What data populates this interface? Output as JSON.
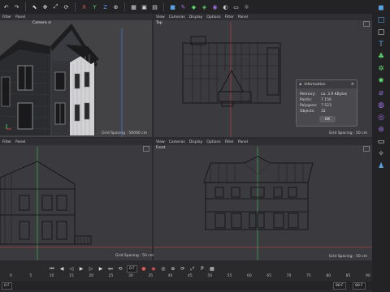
{
  "toolbar": {
    "icons": [
      "undo-icon",
      "redo-icon",
      "select-icon",
      "move-icon",
      "scale-icon",
      "rotate-icon",
      "x-axis-icon",
      "y-axis-icon",
      "z-axis-icon",
      "coordinate-icon",
      "render-view-icon",
      "render-icon",
      "render-settings-icon",
      "cube-icon",
      "pen-icon",
      "subdivision-icon",
      "cloner-icon",
      "deformer-icon",
      "scene-icon",
      "camera-icon",
      "light-icon"
    ],
    "x_label": "X",
    "y_label": "Y",
    "z_label": "Z"
  },
  "viewports": {
    "perspective": {
      "menu": [
        "Filter",
        "Panel"
      ],
      "label": "Camera",
      "camera_icon": "⊙",
      "grid_spacing": "Grid Spacing : 50000 cm"
    },
    "top": {
      "menu": [
        "View",
        "Cameras",
        "Display",
        "Options",
        "Filter",
        "Panel"
      ],
      "label": "Top",
      "grid_spacing": "Grid Spacing : 50 cm"
    },
    "right": {
      "menu": [
        "Filter",
        "Panel"
      ],
      "grid_spacing": ""
    },
    "front": {
      "menu": [
        "View",
        "Cameras",
        "Display",
        "Options",
        "Filter",
        "Panel"
      ],
      "label": "Front",
      "grid_spacing": "Grid Spacing : 50 cm"
    },
    "bottom_left_grid": "Grid Spacing : 50 cm"
  },
  "dialog": {
    "title": "Information",
    "rows": [
      {
        "label": "Memory:",
        "value": "ca. 3.9 KBytes"
      },
      {
        "label": "Points:",
        "value": "7 156"
      },
      {
        "label": "Polygons:",
        "value": "7 523"
      },
      {
        "label": "Objects:",
        "value": "32"
      }
    ],
    "ok_label": "OK"
  },
  "timeline": {
    "current_frame": "0 F",
    "ticks": [
      "0",
      "5",
      "10",
      "15",
      "20",
      "25",
      "30",
      "35",
      "40",
      "45",
      "50",
      "55",
      "60",
      "65",
      "70",
      "75",
      "80",
      "85",
      "90"
    ],
    "start_frame": "0 F",
    "end_frame": "90 F",
    "min_field": "90 F"
  },
  "rightbar": {
    "icons": [
      "cube-icon",
      "square-icon",
      "light-icon",
      "text-icon",
      "tree-icon",
      "gear-icon",
      "atom-icon",
      "tag-icon",
      "scene-icon",
      "sphere-icon",
      "network-icon",
      "camera-icon",
      "light-bulb-icon",
      "rig-icon"
    ]
  },
  "colors": {
    "accent": "#e05a5a",
    "axis_y": "#3ec95a",
    "axis_x": "#d94040",
    "axis_z": "#3b7ae0"
  }
}
